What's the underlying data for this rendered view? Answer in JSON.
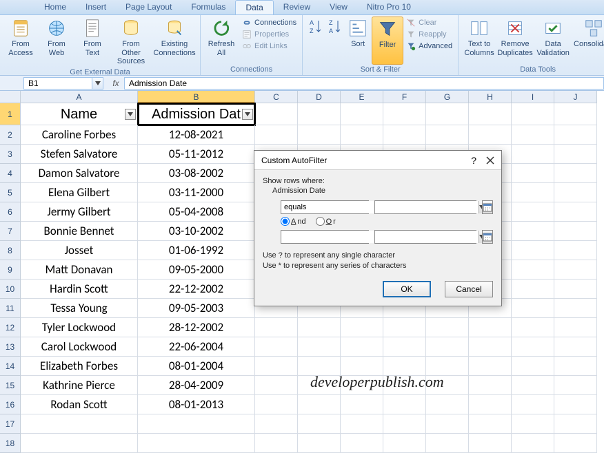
{
  "ribbon": {
    "tabs": [
      "Home",
      "Insert",
      "Page Layout",
      "Formulas",
      "Data",
      "Review",
      "View",
      "Nitro Pro 10"
    ],
    "active_tab": "Data",
    "groups": {
      "get_external": {
        "label": "Get External Data",
        "from_access": "From\nAccess",
        "from_web": "From\nWeb",
        "from_text": "From\nText",
        "from_other": "From Other\nSources",
        "existing": "Existing\nConnections"
      },
      "connections": {
        "label": "Connections",
        "refresh": "Refresh\nAll",
        "connections": "Connections",
        "properties": "Properties",
        "edit_links": "Edit Links"
      },
      "sort_filter": {
        "label": "Sort & Filter",
        "sort": "Sort",
        "filter": "Filter",
        "clear": "Clear",
        "reapply": "Reapply",
        "advanced": "Advanced"
      },
      "data_tools": {
        "label": "Data Tools",
        "text_to_columns": "Text to\nColumns",
        "remove_duplicates": "Remove\nDuplicates",
        "data_validation": "Data\nValidation",
        "consolidate": "Consolidate"
      }
    }
  },
  "namebox": {
    "ref": "B1",
    "formula": "Admission Date"
  },
  "sheet": {
    "columns": [
      "A",
      "B",
      "C",
      "D",
      "E",
      "F",
      "G",
      "H",
      "I",
      "J"
    ],
    "headers": {
      "A": "Name",
      "B": "Admission Dat"
    },
    "rows": [
      {
        "A": "Caroline Forbes",
        "B": "12-08-2021"
      },
      {
        "A": "Stefen Salvatore",
        "B": "05-11-2012"
      },
      {
        "A": "Damon Salvatore",
        "B": "03-08-2002"
      },
      {
        "A": "Elena Gilbert",
        "B": "03-11-2000"
      },
      {
        "A": "Jermy Gilbert",
        "B": "05-04-2008"
      },
      {
        "A": "Bonnie Bennet",
        "B": "03-10-2002"
      },
      {
        "A": "Josset",
        "B": "01-06-1992"
      },
      {
        "A": "Matt Donavan",
        "B": "09-05-2000"
      },
      {
        "A": "Hardin Scott",
        "B": "22-12-2002"
      },
      {
        "A": "Tessa Young",
        "B": "09-05-2003"
      },
      {
        "A": "Tyler Lockwood",
        "B": "28-12-2002"
      },
      {
        "A": "Carol Lockwood",
        "B": "22-06-2004"
      },
      {
        "A": "Elizabeth Forbes",
        "B": "08-01-2004"
      },
      {
        "A": "Kathrine Pierce",
        "B": "28-04-2009"
      },
      {
        "A": "Rodan Scott",
        "B": "08-01-2013"
      }
    ]
  },
  "dialog": {
    "title": "Custom AutoFilter",
    "show_rows": "Show rows where:",
    "field": "Admission Date",
    "op1": "equals",
    "val1": "",
    "and": "And",
    "or": "Or",
    "op2": "",
    "val2": "",
    "hint1": "Use ? to represent any single character",
    "hint2": "Use * to represent any series of characters",
    "ok": "OK",
    "cancel": "Cancel",
    "help": "?"
  },
  "watermark": "developerpublish.com"
}
